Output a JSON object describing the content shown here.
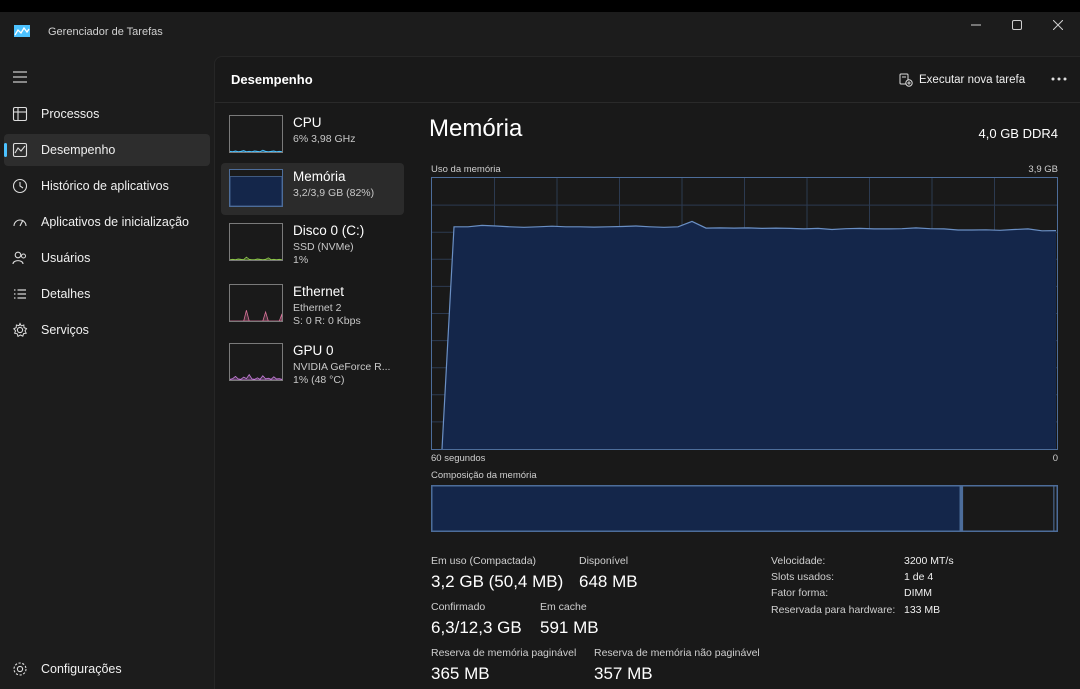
{
  "window": {
    "title": "Gerenciador de Tarefas"
  },
  "nav": {
    "items": [
      {
        "label": "Processos",
        "icon": "processes-icon"
      },
      {
        "label": "Desempenho",
        "icon": "performance-icon",
        "active": true
      },
      {
        "label": "Histórico de aplicativos",
        "icon": "history-icon"
      },
      {
        "label": "Aplicativos de inicialização",
        "icon": "startup-icon"
      },
      {
        "label": "Usuários",
        "icon": "users-icon"
      },
      {
        "label": "Detalhes",
        "icon": "details-icon"
      },
      {
        "label": "Serviços",
        "icon": "services-icon"
      }
    ],
    "settings": {
      "label": "Configurações",
      "icon": "gear-icon"
    }
  },
  "header": {
    "title": "Desempenho",
    "run_task_label": "Executar nova tarefa"
  },
  "devices": [
    {
      "name": "CPU",
      "sub1": "6% 3,98 GHz",
      "sub2": "",
      "color": "#4cc2ff"
    },
    {
      "name": "Memória",
      "sub1": "3,2/3,9 GB (82%)",
      "sub2": "",
      "color": "#4d6d9a",
      "active": true
    },
    {
      "name": "Disco 0 (C:)",
      "sub1": "SSD (NVMe)",
      "sub2": "1%",
      "color": "#8bc34a"
    },
    {
      "name": "Ethernet",
      "sub1": "Ethernet 2",
      "sub2": "S: 0 R: 0 Kbps",
      "color": "#d9739a"
    },
    {
      "name": "GPU 0",
      "sub1": "NVIDIA GeForce R...",
      "sub2": "1% (48 °C)",
      "color": "#c77ddb"
    }
  ],
  "detail": {
    "title": "Memória",
    "spec": "4,0 GB DDR4",
    "usage_label": "Uso da memória",
    "usage_max": "3,9 GB",
    "time_left": "60 segundos",
    "time_right": "0",
    "composition_label": "Composição da memória",
    "usage_percent": [
      0,
      82,
      82,
      82.5,
      82.3,
      82,
      81.8,
      82,
      82.2,
      82,
      82,
      81.9,
      82,
      82.1,
      82.3,
      82,
      81.8,
      82,
      84,
      81.5,
      81.6,
      81.5,
      81.6,
      81.4,
      81.5,
      81.4,
      81.2,
      81.4,
      81,
      81.3,
      81.4,
      81.2,
      81.2,
      81.3,
      81.6,
      81.3,
      81.2,
      80.8,
      80.8,
      80.9,
      80.7,
      81,
      81.2,
      80.5,
      80.6
    ],
    "composition": {
      "in_use": 84.5,
      "modified": 0.4,
      "standby": 14.6,
      "free": 0.5
    },
    "accent_color": "#4d6d9a",
    "fill_color": "#14264a",
    "stats": [
      {
        "label": "Em uso (Compactada)",
        "value": "3,2 GB (50,4 MB)"
      },
      {
        "label": "Disponível",
        "value": "648 MB"
      },
      {
        "label": "Confirmado",
        "value": "6,3/12,3 GB"
      },
      {
        "label": "Em cache",
        "value": "591 MB"
      },
      {
        "label": "Reserva de memória paginável",
        "value": "365 MB"
      },
      {
        "label": "Reserva de memória não paginável",
        "value": "357 MB"
      }
    ],
    "specs": [
      {
        "key": "Velocidade:",
        "value": "3200 MT/s"
      },
      {
        "key": "Slots usados:",
        "value": "1 de 4"
      },
      {
        "key": "Fator forma:",
        "value": "DIMM"
      },
      {
        "key": "Reservada para hardware:",
        "value": "133 MB"
      }
    ]
  }
}
